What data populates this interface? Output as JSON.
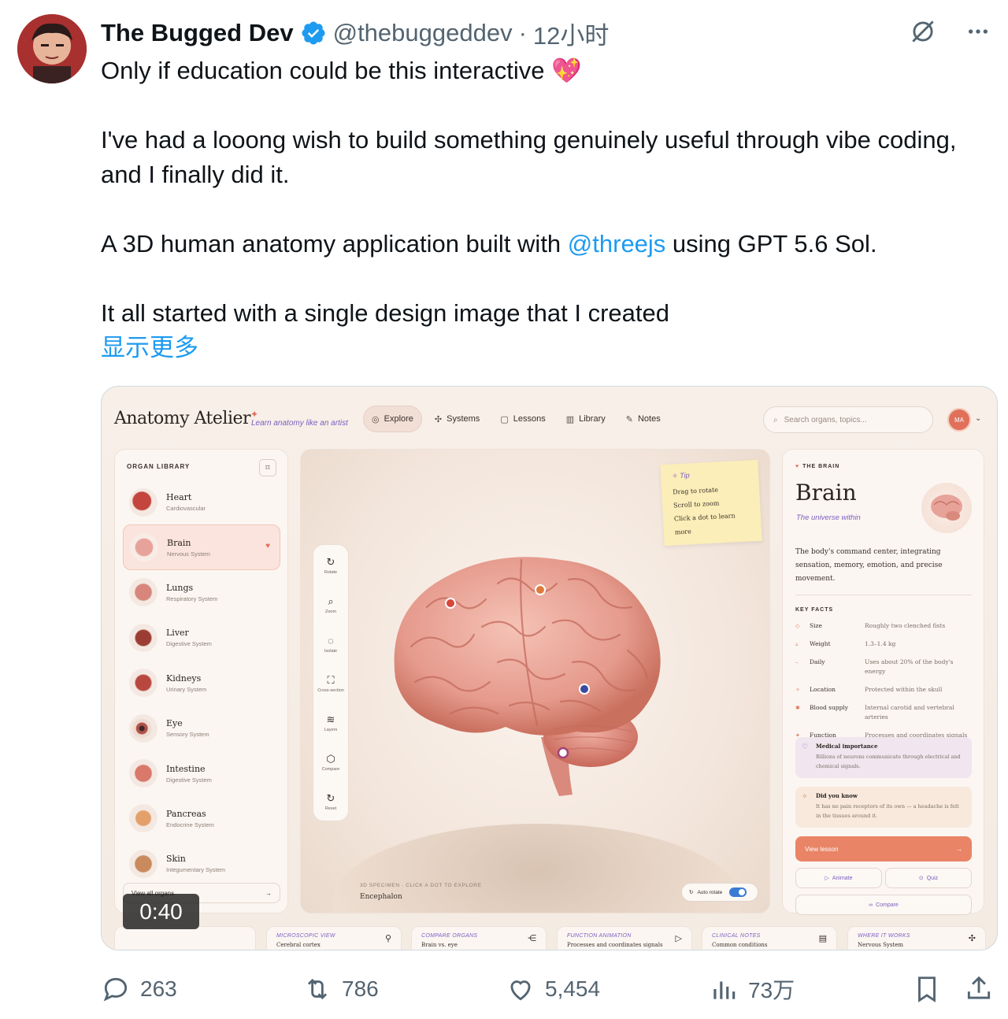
{
  "tweet": {
    "display_name": "The Bugged Dev",
    "handle": "@thebuggeddev",
    "separator": "·",
    "time": "12小时",
    "line1": "Only if education could be this interactive 💖",
    "para2": "I've had a looong wish to build something genuinely useful through vibe coding, and I finally did it.",
    "para3_before": "A 3D human anatomy application built with ",
    "para3_mention": "@threejs",
    "para3_after": " using GPT 5.6 Sol.",
    "para4": "It all started with a single design image that I created",
    "show_more": "显示更多"
  },
  "icons": {
    "verified": "verified-badge-icon",
    "grok": "grok-icon",
    "more": "more-icon",
    "reply": "reply-icon",
    "retweet": "retweet-icon",
    "like": "like-icon",
    "views": "views-icon",
    "bookmark": "bookmark-icon",
    "share": "share-icon"
  },
  "colors": {
    "accent": "#1d9bf0",
    "muted": "#536471",
    "app_coral": "#e98467",
    "app_purple": "#7a5ec0"
  },
  "media": {
    "duration": "0:40",
    "app": {
      "logo": "Anatomy Atelier",
      "tagline": "Learn anatomy like an artist",
      "nav": [
        "Explore",
        "Systems",
        "Lessons",
        "Library",
        "Notes"
      ],
      "search_placeholder": "Search organs, topics...",
      "user_initials": "MA",
      "library_title": "ORGAN LIBRARY",
      "organs": [
        {
          "name": "Heart",
          "system": "Cardiovascular"
        },
        {
          "name": "Brain",
          "system": "Nervous System"
        },
        {
          "name": "Lungs",
          "system": "Respiratory System"
        },
        {
          "name": "Liver",
          "system": "Digestive System"
        },
        {
          "name": "Kidneys",
          "system": "Urinary System"
        },
        {
          "name": "Eye",
          "system": "Sensory System"
        },
        {
          "name": "Intestine",
          "system": "Digestive System"
        },
        {
          "name": "Pancreas",
          "system": "Endocrine System"
        },
        {
          "name": "Skin",
          "system": "Integumentary System"
        }
      ],
      "view_all": "View all organs",
      "tools": [
        "Rotate",
        "Zoom",
        "Isolate",
        "Cross-section",
        "Layers",
        "Compare",
        "Reset"
      ],
      "tip": {
        "title": "Tip",
        "lines": [
          "Drag to rotate",
          "Scroll to zoom",
          "Click a dot to learn",
          "more"
        ]
      },
      "specimen_caption": "3D SPECIMEN · CLICK A DOT TO EXPLORE",
      "specimen_name": "Encephalon",
      "auto_rotate": "Auto rotate",
      "detail": {
        "kicker": "THE BRAIN",
        "title": "Brain",
        "subtitle": "The universe within",
        "description": "The body's command center, integrating sensation, memory, emotion, and precise movement.",
        "facts_title": "KEY FACTS",
        "facts": [
          {
            "label": "Size",
            "value": "Roughly two clenched fists"
          },
          {
            "label": "Weight",
            "value": "1.3–1.4 kg"
          },
          {
            "label": "Daily",
            "value": "Uses about 20% of the body's energy"
          },
          {
            "label": "Location",
            "value": "Protected within the skull"
          },
          {
            "label": "Blood supply",
            "value": "Internal carotid and vertebral arteries"
          },
          {
            "label": "Function",
            "value": "Processes and coordinates signals"
          }
        ],
        "medical_title": "Medical importance",
        "medical_text": "Billions of neurons communicate through electrical and chemical signals.",
        "know_title": "Did you know",
        "know_text": "It has no pain receptors of its own — a headache is felt in the tissues around it.",
        "lesson": "View lesson",
        "animate": "Animate",
        "quiz": "Quiz",
        "compare": "Compare"
      },
      "bottom_cards": [
        {
          "label": "MICROSCOPIC VIEW",
          "sub": "Cerebral cortex"
        },
        {
          "label": "COMPARE ORGANS",
          "sub": "Brain vs. eye"
        },
        {
          "label": "FUNCTION ANIMATION",
          "sub": "Processes and coordinates signals"
        },
        {
          "label": "CLINICAL NOTES",
          "sub": "Common conditions"
        },
        {
          "label": "WHERE IT WORKS",
          "sub": "Nervous System"
        }
      ]
    }
  },
  "actions": {
    "replies": "263",
    "retweets": "786",
    "likes": "5,454",
    "views": "73万"
  }
}
